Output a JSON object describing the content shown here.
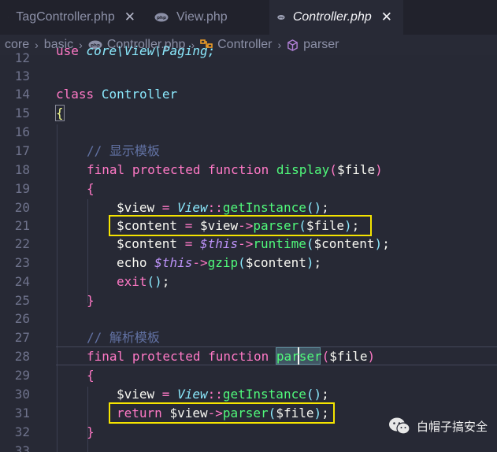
{
  "tabs": [
    {
      "label": "TagController.php",
      "close": "✕",
      "active": false
    },
    {
      "label": "View.php",
      "close": "",
      "active": false
    },
    {
      "label": "Controller.php",
      "close": "✕",
      "active": true
    }
  ],
  "breadcrumb": {
    "items": [
      "core",
      "basic",
      "Controller.php",
      "Controller",
      "parser"
    ],
    "separator": "›"
  },
  "code": {
    "line_numbers": [
      "12",
      "13",
      "14",
      "15",
      "16",
      "17",
      "18",
      "19",
      "20",
      "21",
      "22",
      "23",
      "24",
      "25",
      "26",
      "27",
      "28",
      "29",
      "30",
      "31",
      "32",
      "33"
    ],
    "tokens": {
      "use": "use",
      "core_path": "core\\View\\Paging;",
      "class_kw": "class",
      "class_name": "Controller",
      "open_brace": "{",
      "close_brace": "}",
      "comment1": "// 显示模板",
      "comment2": "// 解析模板",
      "final": "final",
      "protected": "protected",
      "function": "function",
      "display": "display",
      "parser": "parser",
      "lparen": "(",
      "rparen": ")",
      "arg_file": "$file",
      "view_var": "$view",
      "content_var": "$content",
      "assign": " = ",
      "View": "View",
      "dcolon": "::",
      "getInstance": "getInstance",
      "empty_call": "()",
      "semi": ";",
      "arrow": "->",
      "this": "$this",
      "runtime": "runtime",
      "echo": "echo",
      "gzip": "gzip",
      "exit": "exit",
      "return": "return",
      "sp": " "
    }
  },
  "watermark": {
    "text": "白帽子搞安全",
    "icon": "wechat-icon"
  },
  "colors": {
    "background": "#272935",
    "highlight_box": "#f5e400",
    "keyword": "#ff79c6",
    "function": "#50fa7b",
    "class": "#8be9fd",
    "comment": "#6272a4"
  }
}
